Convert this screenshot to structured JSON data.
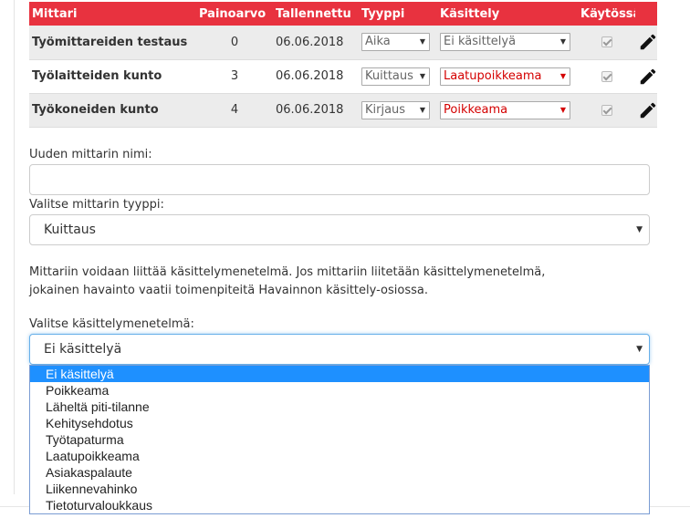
{
  "table": {
    "headers": {
      "name": "Mittari",
      "weight": "Painoarvo",
      "saved": "Tallennettu",
      "type": "Tyyppi",
      "handling": "Käsittely",
      "in_use": "Käytössä"
    },
    "rows": [
      {
        "name": "Työmittareiden testaus",
        "weight": "0",
        "saved": "06.06.2018",
        "type": "Aika",
        "handling": "Ei käsittelyä",
        "handling_active": false,
        "in_use": true
      },
      {
        "name": "Työlaitteiden kunto",
        "weight": "3",
        "saved": "06.06.2018",
        "type": "Kuittaus",
        "handling": "Laatupoikkeama",
        "handling_active": true,
        "in_use": true
      },
      {
        "name": "Työkoneiden kunto",
        "weight": "4",
        "saved": "06.06.2018",
        "type": "Kirjaus",
        "handling": "Poikkeama",
        "handling_active": true,
        "in_use": true
      }
    ]
  },
  "form": {
    "name_label": "Uuden mittarin nimi:",
    "name_value": "",
    "type_label": "Valitse mittarin tyyppi:",
    "type_value": "Kuittaus",
    "info_line1": "Mittariin voidaan liittää käsittelymenetelmä. Jos mittariin liitetään käsittelymenetelmä,",
    "info_line2": "jokainen havainto vaatii toimenpiteitä Havainnon käsittely-osiossa.",
    "handling_label": "Valitse käsittelymenetelmä:",
    "handling_value": "Ei käsittelyä",
    "handling_options": [
      "Ei käsittelyä",
      "Poikkeama",
      "Läheltä piti-tilanne",
      "Kehitysehdotus",
      "Työtapaturma",
      "Laatupoikkeama",
      "Asiakaspalaute",
      "Liikennevahinko",
      "Tietoturvaloukkaus"
    ],
    "handling_selected_index": 0
  },
  "colors": {
    "header_bg": "#e8323f",
    "active_text": "#d40000",
    "dropdown_highlight": "#1e90ff"
  },
  "icons": {
    "edit": "pencil-icon",
    "caret": "chevron-down-icon",
    "checkbox": "checkbox-checked-icon"
  }
}
